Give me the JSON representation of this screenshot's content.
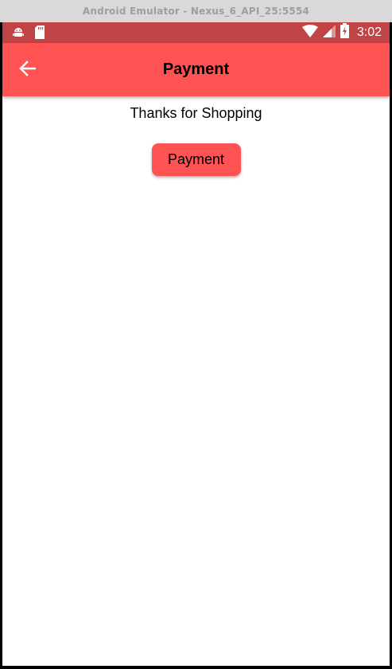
{
  "window": {
    "title": "Android Emulator - Nexus_6_API_25:5554"
  },
  "status_bar": {
    "time": "3:02",
    "left_icons": [
      "android-debug-icon",
      "sd-card-icon"
    ],
    "right_icons": [
      "wifi-icon",
      "cell-signal-icon",
      "battery-charging-icon"
    ],
    "color": "#c04446"
  },
  "app_bar": {
    "title": "Payment",
    "back_icon": "arrow-back-icon",
    "color": "#ff5252"
  },
  "main": {
    "message": "Thanks for Shopping",
    "payment_button_label": "Payment"
  }
}
